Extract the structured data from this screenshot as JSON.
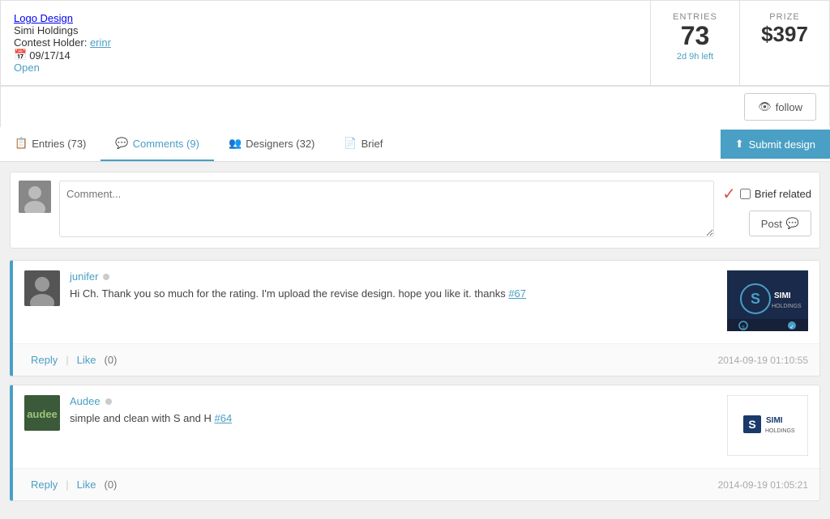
{
  "header": {
    "logo_label": "Logo Design",
    "company_name": "Simi Holdings",
    "contest_holder_label": "Contest Holder:",
    "holder_name": "erinr",
    "date": "09/17/14",
    "status": "Open",
    "follow_label": "follow"
  },
  "stats": {
    "entries_label": "ENTRIES",
    "entries_value": "73",
    "entries_sub": "2d 9h left",
    "prize_label": "PRIZE",
    "prize_value": "$397"
  },
  "tabs": [
    {
      "id": "entries",
      "label": "Entries (73)",
      "icon": "📋"
    },
    {
      "id": "comments",
      "label": "Comments (9)",
      "icon": "💬",
      "active": true
    },
    {
      "id": "designers",
      "label": "Designers (32)",
      "icon": "👥"
    },
    {
      "id": "brief",
      "label": "Brief",
      "icon": "📄"
    }
  ],
  "submit_btn": "Submit design",
  "comment_box": {
    "placeholder": "Comment...",
    "brief_related_label": "Brief related",
    "post_label": "Post"
  },
  "comments": [
    {
      "id": 1,
      "username": "junifer",
      "online": true,
      "text": "Hi Ch. Thank you so much for the rating. I'm upload the revise design. hope you like it. thanks",
      "hash_link": "#67",
      "timestamp": "2014-09-19 01:10:55",
      "reply_label": "Reply",
      "like_label": "Like",
      "like_count": "(0)",
      "has_preview": true,
      "preview_type": "dark"
    },
    {
      "id": 2,
      "username": "Audee",
      "online": true,
      "text": "simple and clean with S and H",
      "hash_link": "#64",
      "timestamp": "2014-09-19 01:05:21",
      "reply_label": "Reply",
      "like_label": "Like",
      "like_count": "(0)",
      "has_preview": true,
      "preview_type": "light"
    }
  ]
}
